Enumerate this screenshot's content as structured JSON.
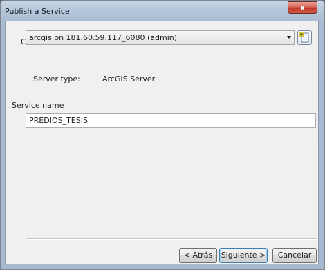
{
  "window": {
    "title": "Publish a Service",
    "close_label": "x"
  },
  "connection": {
    "section_label": "Choose a connection",
    "selected": "arcgis on 181.60.59.117_6080 (admin)",
    "server_type_label": "Server type:",
    "server_type_value": "ArcGIS Server"
  },
  "service": {
    "name_label": "Service name",
    "name_value": "PREDIOS_TESIS"
  },
  "buttons": {
    "back": "< Atrás",
    "next": "Siguiente >",
    "cancel": "Cancelar"
  }
}
